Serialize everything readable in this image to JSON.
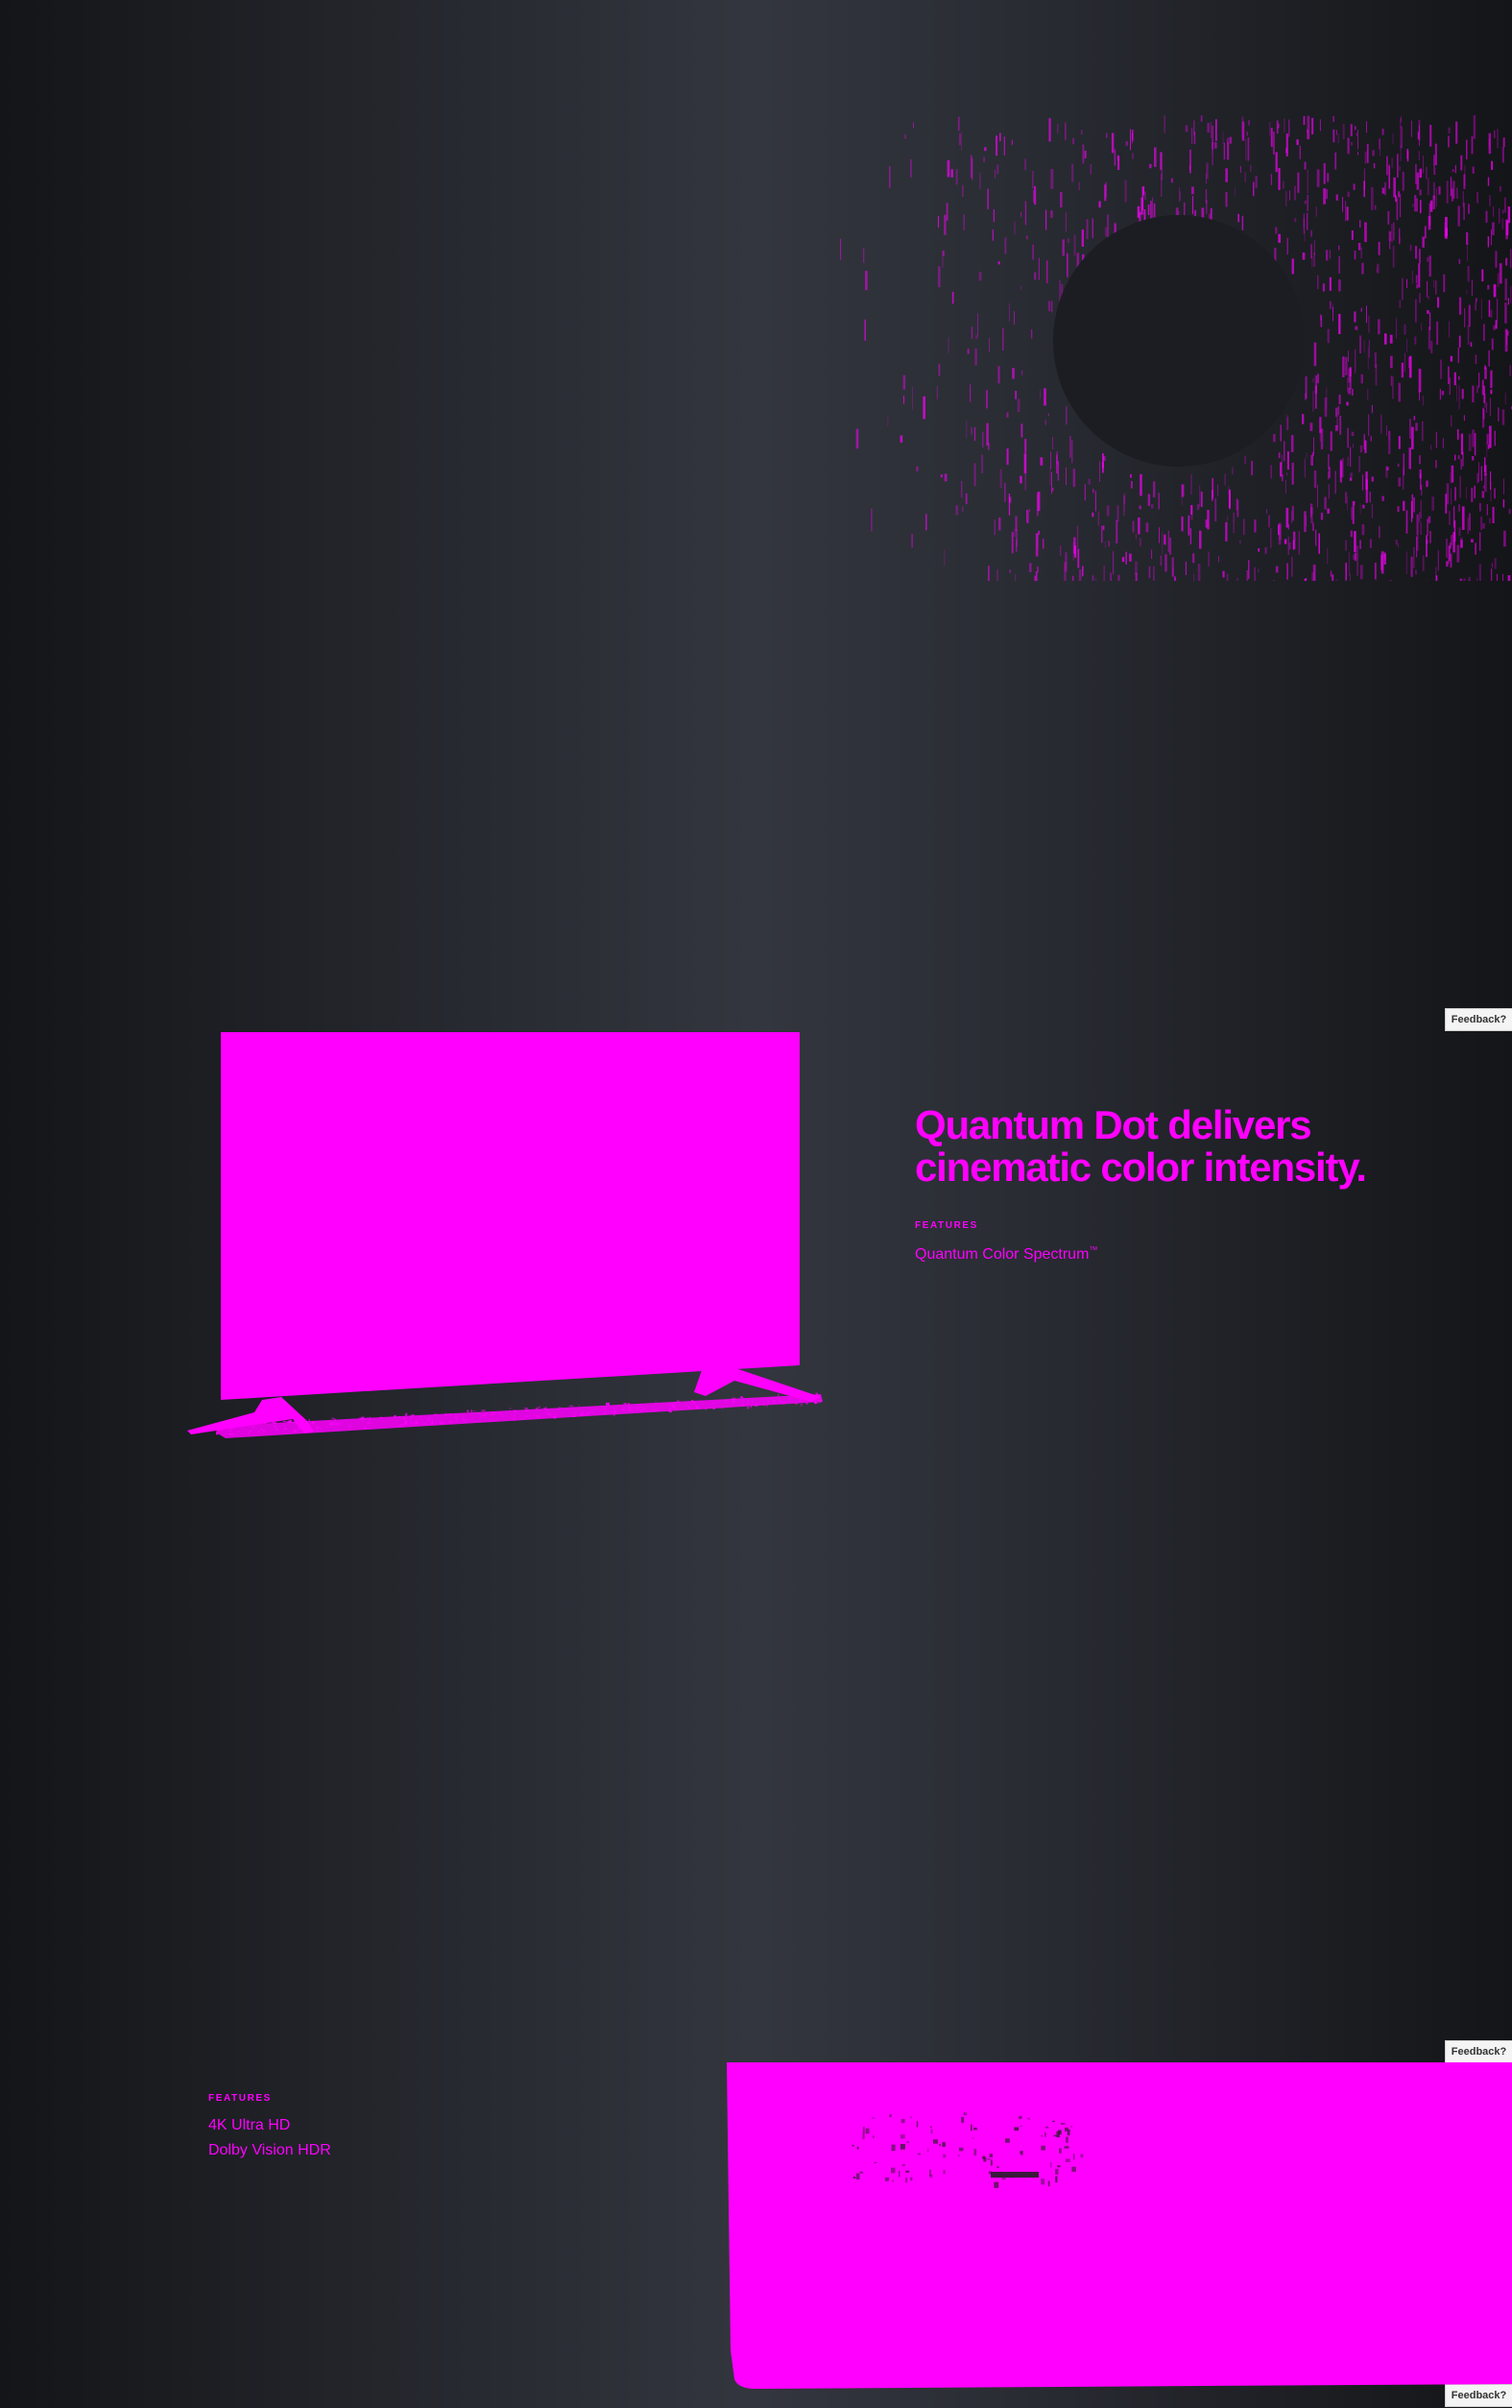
{
  "colors": {
    "accent": "#ff00ff",
    "background_dark": "#141518",
    "background_mid": "#33363e",
    "feedback_tab_bg": "#f4f4f4"
  },
  "feedback": {
    "label": "Feedback?"
  },
  "quantum_dot": {
    "headline_line1": "Quantum Dot delivers",
    "headline_line2": "cinematic color intensity.",
    "features_label": "FEATURES",
    "features": [
      {
        "name": "Quantum Color Spectrum",
        "mark": "™"
      }
    ]
  },
  "bottom_section": {
    "features_label": "FEATURES",
    "features": [
      {
        "name": "4K Ultra HD"
      },
      {
        "name": "Dolby Vision HDR"
      }
    ]
  },
  "icons": {
    "hero": "particle-ring-graphic",
    "tv": "tv-illustration",
    "bottom": "tv-screen-closeup"
  }
}
